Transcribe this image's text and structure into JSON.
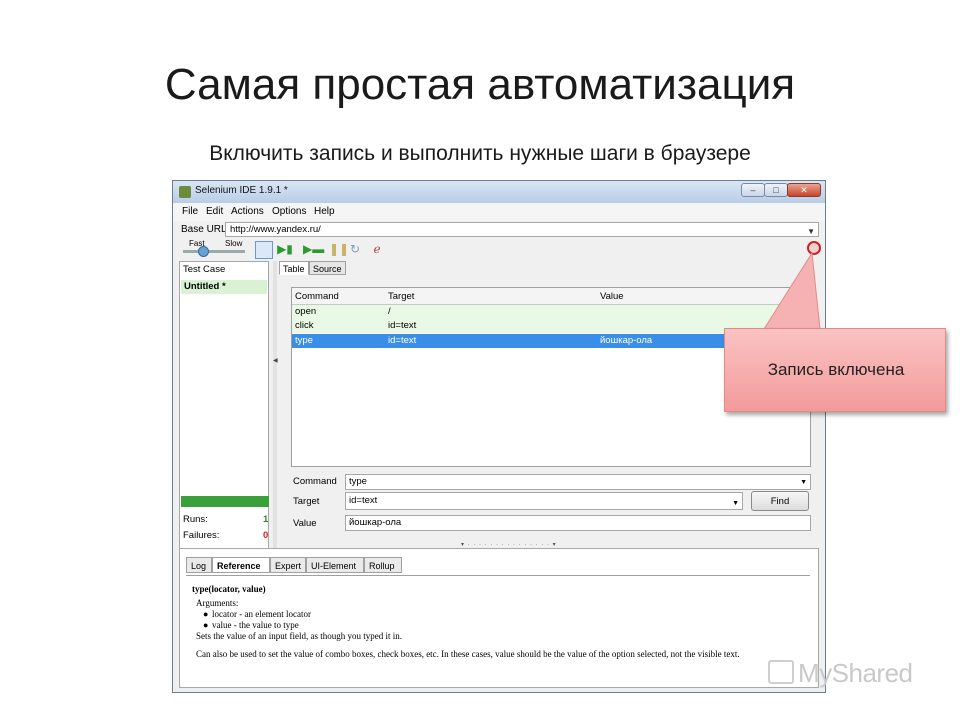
{
  "slide": {
    "title": "Самая простая автоматизация",
    "subtitle": "Включить запись и выполнить нужные шаги в браузере"
  },
  "window": {
    "title": "Selenium IDE 1.9.1 *",
    "min_glyph": "–",
    "max_glyph": "□",
    "close_glyph": "✕"
  },
  "menu": [
    "File",
    "Edit",
    "Actions",
    "Options",
    "Help"
  ],
  "base_url": {
    "label": "Base URL",
    "value": "http://www.yandex.ru/"
  },
  "speed": {
    "fast": "Fast",
    "slow": "Slow"
  },
  "test_cases": {
    "header": "Test Case",
    "items": [
      "Untitled *"
    ]
  },
  "stats": {
    "runs_label": "Runs:",
    "runs": "1",
    "failures_label": "Failures:",
    "failures": "0",
    "progress": 1.0
  },
  "editor_tabs": [
    "Table",
    "Source"
  ],
  "table": {
    "headers": [
      "Command",
      "Target",
      "Value"
    ],
    "rows": [
      [
        "open",
        "/",
        ""
      ],
      [
        "click",
        "id=text",
        ""
      ],
      [
        "type",
        "id=text",
        "йошкар-ола"
      ]
    ]
  },
  "fields": {
    "command_label": "Command",
    "command": "type",
    "target_label": "Target",
    "target": "id=text",
    "value_label": "Value",
    "value": "йошкар-ола",
    "find": "Find"
  },
  "bottom_tabs": [
    "Log",
    "Reference",
    "Expert",
    "UI-Element",
    "Rollup"
  ],
  "reference": {
    "signature": "type(locator, value)",
    "arguments": "Arguments:",
    "arg1": "locator - an element locator",
    "arg2": "value - the value to type",
    "desc1": "Sets the value of an input field, as though you typed it in.",
    "desc2": "Can also be used to set the value of combo boxes, check boxes, etc. In these cases, value should be the value of the option selected, not the visible text."
  },
  "callout": {
    "text": "Запись включена"
  },
  "watermark": "MyShared",
  "colors": {
    "record": "#cc2222",
    "callout": "#f4a8a8",
    "selected_row": "#3b8ee8",
    "executed_row": "#eaf9e6"
  }
}
